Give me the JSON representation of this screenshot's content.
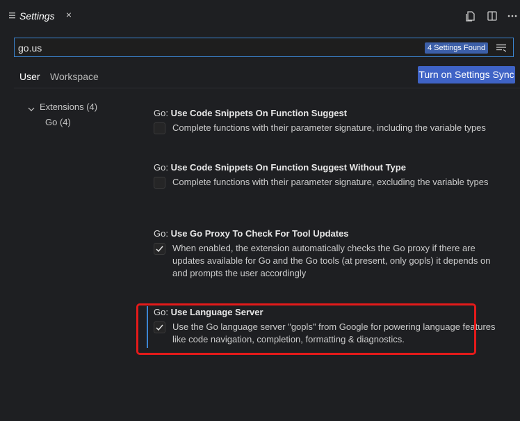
{
  "tab": {
    "title": "Settings",
    "icon": "settings-list-icon",
    "close": "×"
  },
  "actions": [
    "open-settings-json-icon",
    "split-editor-icon",
    "more-actions-icon"
  ],
  "search": {
    "value": "go.us",
    "results_badge": "4 Settings Found",
    "filter_icon": "filter-lines-icon"
  },
  "scopes": {
    "user": "User",
    "workspace": "Workspace"
  },
  "sync_button": "Turn on Settings Sync",
  "toc": {
    "extensions": "Extensions (4)",
    "go": "Go (4)"
  },
  "settings": [
    {
      "prefix": "Go: ",
      "name": "Use Code Snippets On Function Suggest",
      "checked": false,
      "description": "Complete functions with their parameter signature, including the variable types"
    },
    {
      "prefix": "Go: ",
      "name": "Use Code Snippets On Function Suggest Without Type",
      "checked": false,
      "description": "Complete functions with their parameter signature, excluding the variable types"
    },
    {
      "prefix": "Go: ",
      "name": "Use Go Proxy To Check For Tool Updates",
      "checked": true,
      "description": "When enabled, the extension automatically checks the Go proxy if there are updates available for Go and the Go tools (at present, only gopls) it depends on and prompts the user accordingly"
    },
    {
      "prefix": "Go: ",
      "name": "Use Language Server",
      "checked": true,
      "description": "Use the Go language server \"gopls\" from Google for powering language features like code navigation, completion, formatting & diagnostics."
    }
  ],
  "colors": {
    "accent": "#3c86d3",
    "highlight": "#e41a1a",
    "sync_button": "#3f63c6"
  }
}
